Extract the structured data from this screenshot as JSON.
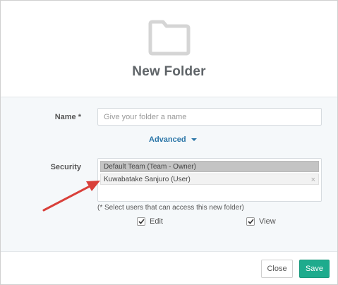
{
  "dialog": {
    "title": "New Folder",
    "icon": "folder-icon"
  },
  "form": {
    "name_label": "Name *",
    "name_placeholder": "Give your folder a name",
    "name_value": "",
    "advanced_label": "Advanced",
    "security_label": "Security",
    "security_entries": [
      {
        "label": "Default Team (Team - Owner)"
      },
      {
        "label": "Kuwabatake Sanjuro (User)",
        "remove_glyph": "×"
      }
    ],
    "hint": "(* Select users that can access this new folder)",
    "permissions": [
      {
        "label": "Edit",
        "checked": true
      },
      {
        "label": "View",
        "checked": true
      }
    ]
  },
  "footer": {
    "close_label": "Close",
    "save_label": "Save"
  },
  "colors": {
    "accent_link": "#2a75a7",
    "save_button": "#1eab8d",
    "annotation_arrow": "#d9403a"
  }
}
